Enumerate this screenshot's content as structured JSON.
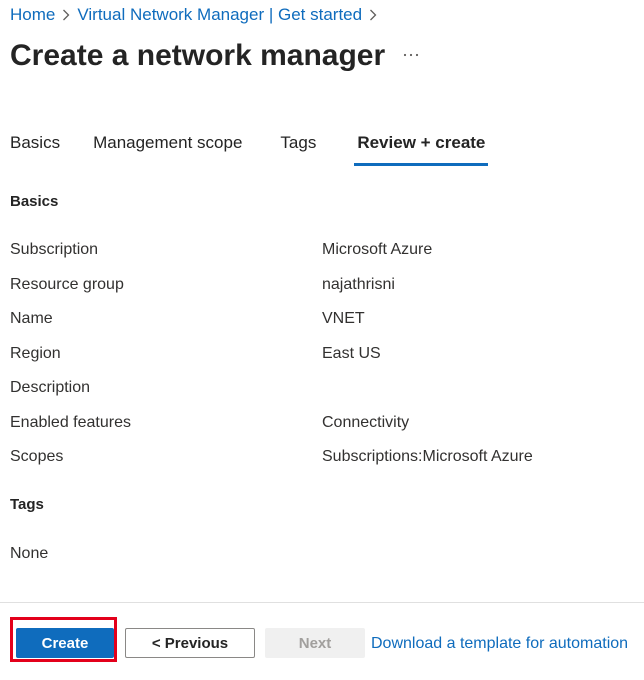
{
  "breadcrumb": {
    "items": [
      "Home",
      "Virtual Network Manager | Get started"
    ]
  },
  "page": {
    "title": "Create a network manager",
    "more_icon": "ellipsis-icon"
  },
  "tabs": [
    {
      "label": "Basics",
      "active": false
    },
    {
      "label": "Management scope",
      "active": false
    },
    {
      "label": "Tags",
      "active": false
    },
    {
      "label": "Review + create",
      "active": true
    }
  ],
  "basics": {
    "heading": "Basics",
    "rows": [
      {
        "label": "Subscription",
        "value": "Microsoft Azure"
      },
      {
        "label": "Resource group",
        "value": "najathrisni"
      },
      {
        "label": "Name",
        "value": "VNET"
      },
      {
        "label": "Region",
        "value": "East US"
      },
      {
        "label": "Description",
        "value": ""
      },
      {
        "label": "Enabled features",
        "value": "Connectivity"
      },
      {
        "label": "Scopes",
        "value": "Subscriptions:Microsoft Azure"
      }
    ]
  },
  "tags": {
    "heading": "Tags",
    "value": "None"
  },
  "footer": {
    "create_label": "Create",
    "previous_label": "< Previous",
    "next_label": "Next",
    "template_link": "Download a template for automation"
  },
  "colors": {
    "accent": "#0f6cbd",
    "highlight": "#e3001b"
  }
}
